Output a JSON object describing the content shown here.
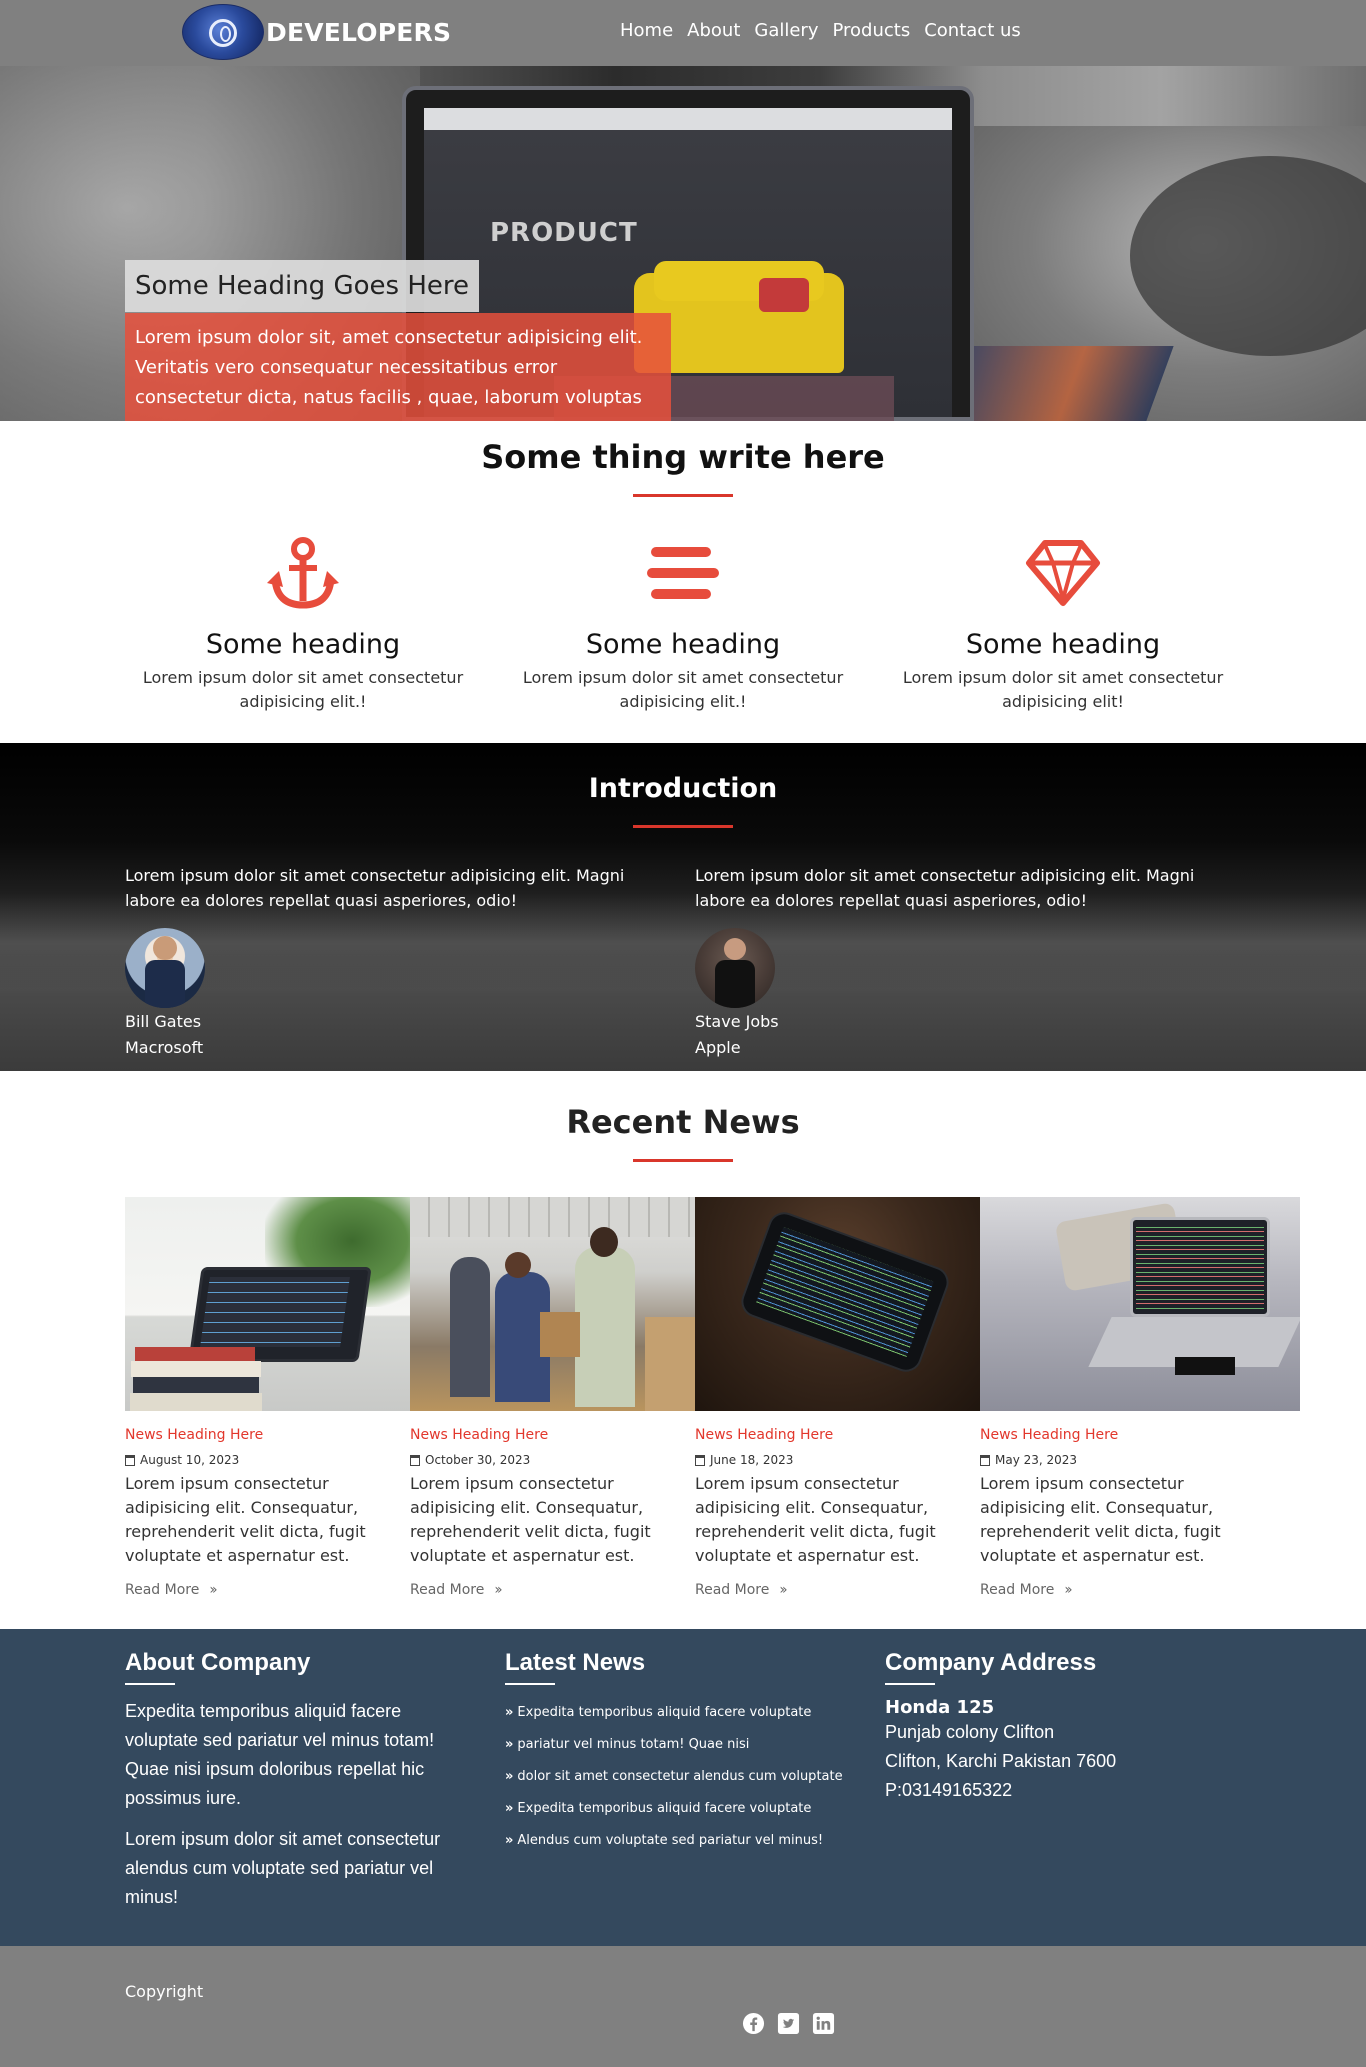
{
  "brand": {
    "name": "DEVELOPERS"
  },
  "nav": {
    "items": [
      "Home",
      "About",
      "Gallery",
      "Products",
      "Contact us"
    ]
  },
  "hero": {
    "heading": "Some Heading Goes Here",
    "text": "Lorem ipsum dolor sit, amet consectetur adipisicing elit. Veritatis vero consequatur necessitatibus error consectetur dicta, natus facilis , quae, laborum voluptas",
    "screen_word": "PRODUCT"
  },
  "features": {
    "title": "Some thing write here",
    "items": [
      {
        "icon": "anchor-icon",
        "heading": "Some heading",
        "text": "Lorem ipsum dolor sit amet consectetur adipisicing elit.!"
      },
      {
        "icon": "bars-icon",
        "heading": "Some heading",
        "text": "Lorem ipsum dolor sit amet consectetur adipisicing elit.!"
      },
      {
        "icon": "diamond-icon",
        "heading": "Some heading",
        "text": "Lorem ipsum dolor sit amet consectetur adipisicing elit!"
      }
    ]
  },
  "intro": {
    "title": "Introduction",
    "testimonials": [
      {
        "text": "Lorem ipsum dolor sit amet consectetur adipisicing elit. Magni labore ea dolores repellat quasi asperiores, odio!",
        "name": "Bill Gates",
        "company": "Macrosoft"
      },
      {
        "text": "Lorem ipsum dolor sit amet consectetur adipisicing elit. Magni labore ea dolores repellat quasi asperiores, odio!",
        "name": "Stave Jobs",
        "company": "Apple"
      }
    ]
  },
  "news": {
    "title": "Recent News",
    "cards": [
      {
        "heading": "News Heading Here",
        "date": "August 10, 2023",
        "text": "Lorem ipsum consectetur adipisicing elit. Consequatur, reprehenderit velit dicta, fugit voluptate et aspernatur est.",
        "more": "Read More"
      },
      {
        "heading": "News Heading Here",
        "date": "October 30, 2023",
        "text": "Lorem ipsum consectetur adipisicing elit. Consequatur, reprehenderit velit dicta, fugit voluptate et aspernatur est.",
        "more": "Read More"
      },
      {
        "heading": "News Heading Here",
        "date": "June 18, 2023",
        "text": "Lorem ipsum consectetur adipisicing elit. Consequatur, reprehenderit velit dicta, fugit voluptate et aspernatur est.",
        "more": "Read More"
      },
      {
        "heading": "News Heading Here",
        "date": "May 23, 2023",
        "text": "Lorem ipsum consectetur adipisicing elit. Consequatur, reprehenderit velit dicta, fugit voluptate et aspernatur est.",
        "more": "Read More"
      }
    ]
  },
  "footer": {
    "about": {
      "title": "About Company",
      "p1": "Expedita temporibus aliquid facere voluptate sed pariatur vel minus totam! Quae nisi ipsum doloribus repellat hic possimus iure.",
      "p2": "Lorem ipsum dolor sit amet consectetur alendus cum voluptate sed pariatur vel minus!"
    },
    "latest": {
      "title": "Latest News",
      "items": [
        "Expedita temporibus aliquid facere voluptate",
        "pariatur vel minus totam! Quae nisi",
        "dolor sit amet consectetur alendus cum voluptate",
        "Expedita temporibus aliquid facere voluptate",
        "Alendus cum voluptate sed pariatur vel minus!"
      ]
    },
    "address": {
      "title": "Company Address",
      "name": "Honda 125",
      "line1": "Punjab colony Clifton",
      "line2": "Clifton, Karchi Pakistan 7600",
      "phone": "P:03149165322"
    }
  },
  "bottom": {
    "copyright": "Copyright",
    "socials": [
      "facebook-icon",
      "twitter-icon",
      "linkedin-icon"
    ]
  },
  "colors": {
    "accent": "#e74c3c",
    "footer_bg": "#34495e",
    "nav_bg": "#808080"
  }
}
